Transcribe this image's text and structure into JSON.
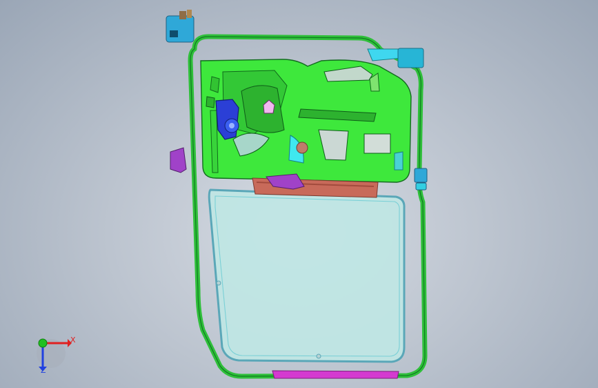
{
  "viewport": {
    "background_top": "#c9d0da",
    "background_bottom": "#9aa6b6"
  },
  "model": {
    "parts": [
      {
        "name": "door-inner-panel",
        "color": "#3ee83c"
      },
      {
        "name": "door-frame-seal",
        "color": "#2fbf3a"
      },
      {
        "name": "window-glass",
        "color": "#bfe6e4"
      },
      {
        "name": "window-regulator-motor",
        "color": "#2b3fd6"
      },
      {
        "name": "door-handle-bracket",
        "color": "#a042c8"
      },
      {
        "name": "mirror-mount-bracket",
        "color": "#2fa8d8"
      },
      {
        "name": "belt-line-strip",
        "color": "#c86a5a"
      },
      {
        "name": "lower-sill-strip",
        "color": "#d43ad0"
      }
    ]
  },
  "triad": {
    "x_label": "X",
    "z_label": "Z",
    "x_color": "#e02020",
    "y_color": "#20c020",
    "z_color": "#2040e0"
  }
}
